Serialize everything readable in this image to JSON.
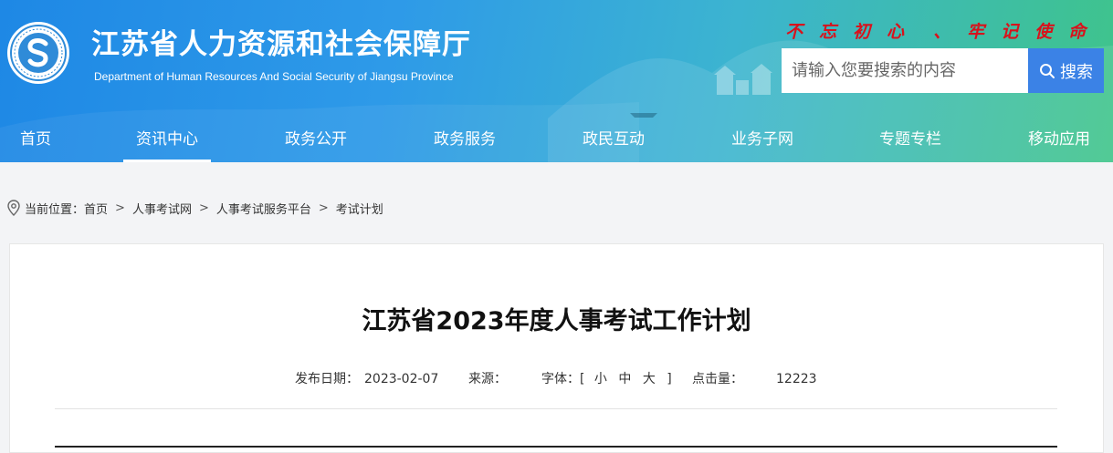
{
  "header": {
    "title": "江苏省人力资源和社会保障厅",
    "subtitle": "Department of Human Resources And Social Security of Jiangsu Province",
    "slogan": [
      "不",
      "忘",
      "初",
      "心",
      "、",
      "牢",
      "记",
      "使",
      "命"
    ],
    "search_placeholder": "请输入您要搜索的内容",
    "search_button": "搜索",
    "colors": {
      "gradient_start": "#1e88e5",
      "gradient_end": "#3fc48a",
      "slogan": "#d8121c",
      "search_button": "#3b82e6"
    }
  },
  "nav": {
    "items": [
      {
        "label": "首页"
      },
      {
        "label": "资讯中心",
        "active": true
      },
      {
        "label": "政务公开"
      },
      {
        "label": "政务服务"
      },
      {
        "label": "政民互动"
      },
      {
        "label": "业务子网"
      },
      {
        "label": "专题专栏"
      },
      {
        "label": "移动应用"
      }
    ]
  },
  "breadcrumb": {
    "prefix": "当前位置：",
    "items": [
      "首页",
      "人事考试网",
      "人事考试服务平台",
      "考试计划"
    ],
    "separator": ">"
  },
  "article": {
    "title": "江苏省2023年度人事考试工作计划",
    "date_label": "发布日期：",
    "date": "2023-02-07",
    "source_label": "来源：",
    "source": "",
    "font_label": "字体：",
    "font_open": "[",
    "font_small": "小",
    "font_medium": "中",
    "font_large": "大",
    "font_close": "]",
    "views_label": "点击量：",
    "views": "12223"
  }
}
